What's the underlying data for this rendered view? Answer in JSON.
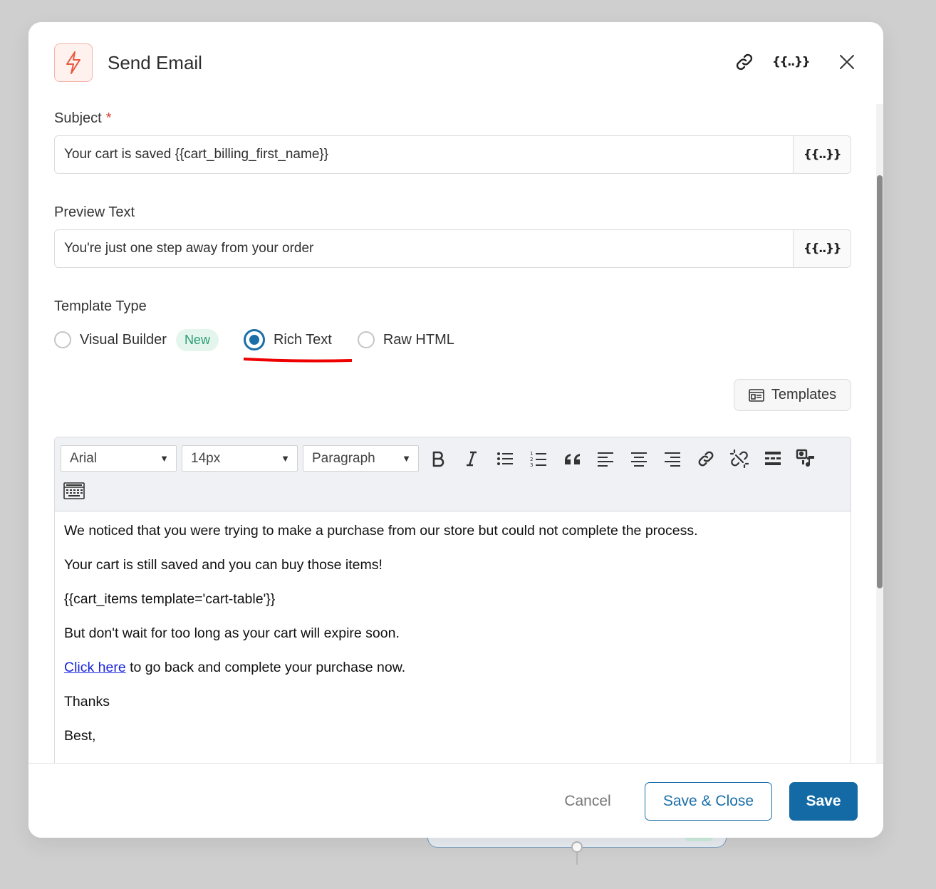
{
  "modal": {
    "title": "Send Email",
    "merge_tag_glyph": "{{..}}"
  },
  "subject": {
    "label": "Subject",
    "required_mark": "*",
    "value": "Your cart is saved {{cart_billing_first_name}}"
  },
  "preview_text": {
    "label": "Preview Text",
    "value": "You're just one step away from your order"
  },
  "template_type": {
    "label": "Template Type",
    "options": [
      {
        "label": "Visual Builder",
        "badge": "New",
        "selected": false
      },
      {
        "label": "Rich Text",
        "selected": true
      },
      {
        "label": "Raw HTML",
        "selected": false
      }
    ]
  },
  "templates_button": "Templates",
  "toolbar": {
    "font_family": "Arial",
    "font_size": "14px",
    "block_format": "Paragraph"
  },
  "body": {
    "lines": [
      "We noticed that you were trying to make a purchase from our store but could not complete the process.",
      "Your cart is still saved and you can buy those items!",
      "{{cart_items template='cart-table'}}",
      "But don't wait for too long as your cart will expire soon."
    ],
    "link_text": "Click here",
    "link_trailing": " to go back and complete your purchase now.",
    "closing": [
      "Thanks",
      "Best,"
    ]
  },
  "footer": {
    "cancel": "Cancel",
    "save_close": "Save & Close",
    "save": "Save"
  },
  "colors": {
    "primary": "#136aa5",
    "accent_bolt": "#e8593f",
    "new_badge_bg": "#e3f5ed",
    "new_badge_text": "#2a9d73",
    "annotation_red": "#ee0000"
  }
}
